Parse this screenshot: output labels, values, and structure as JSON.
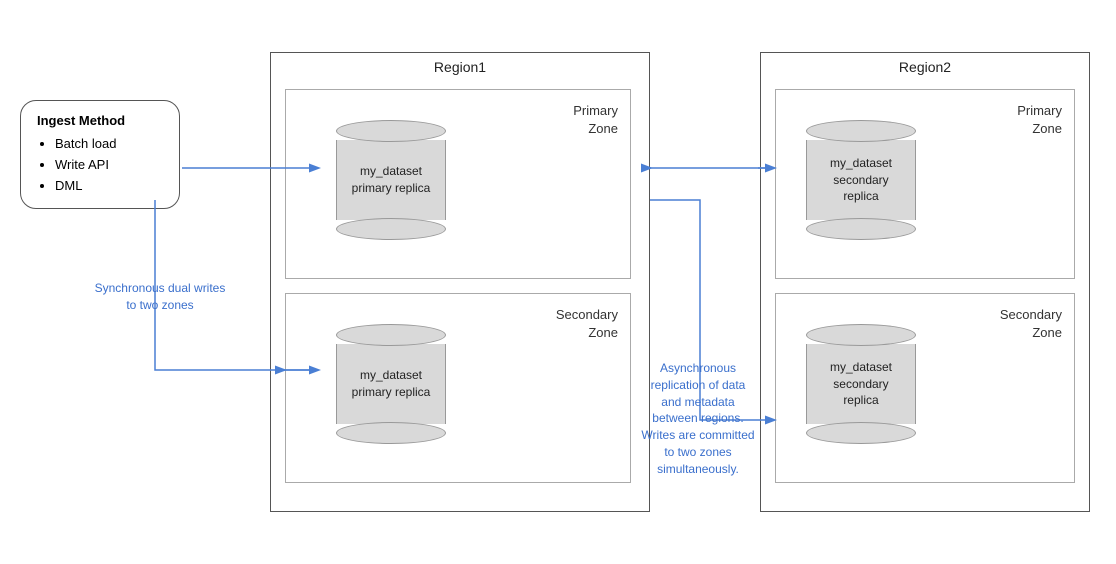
{
  "ingest": {
    "title": "Ingest Method",
    "items": [
      "Batch load",
      "Write API",
      "DML"
    ]
  },
  "region1": {
    "label": "Region1",
    "primaryZone": {
      "label": [
        "Primary",
        "Zone"
      ],
      "db": {
        "line1": "my_dataset",
        "line2": "primary replica"
      }
    },
    "secondaryZone": {
      "label": [
        "Secondary",
        "Zone"
      ],
      "db": {
        "line1": "my_dataset",
        "line2": "primary replica"
      }
    }
  },
  "region2": {
    "label": "Region2",
    "primaryZone": {
      "label": [
        "Primary",
        "Zone"
      ],
      "db": {
        "line1": "my_dataset",
        "line2": "secondary",
        "line3": "replica"
      }
    },
    "secondaryZone": {
      "label": [
        "Secondary",
        "Zone"
      ],
      "db": {
        "line1": "my_dataset",
        "line2": "secondary",
        "line3": "replica"
      }
    }
  },
  "labels": {
    "syncLabel": "Synchronous dual writes\nto two zones",
    "asyncLabel": "Asynchronous\nreplication of data\nand metadata\nbetween regions.\nWrites are committed\nto two zones\nsimultaneously."
  }
}
